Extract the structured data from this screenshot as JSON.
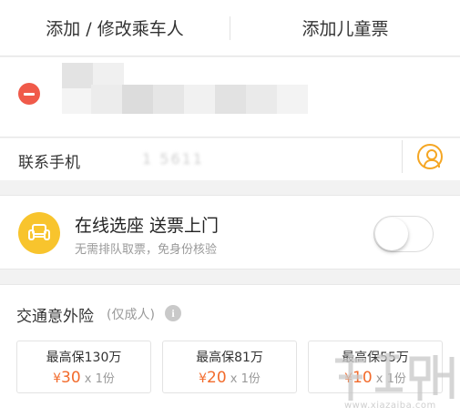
{
  "tabs": {
    "edit_passenger": "添加 / 修改乘车人",
    "add_child_ticket": "添加儿童票"
  },
  "contact": {
    "label": "联系手机",
    "phone": "1         5611"
  },
  "seat_service": {
    "title": "在线选座  送票上门",
    "subtitle": "无需排队取票，免身份核验",
    "toggle_on": false
  },
  "insurance": {
    "title": "交通意外险",
    "note": "(仅成人)",
    "info_icon_glyph": "i",
    "plans": [
      {
        "coverage": "最高保130万",
        "currency": "¥",
        "price": "30",
        "qty": "x 1份"
      },
      {
        "coverage": "最高保81万",
        "currency": "¥",
        "price": "20",
        "qty": "x 1份"
      },
      {
        "coverage": "最高保55万",
        "currency": "¥",
        "price": "10",
        "qty": "x 1份"
      }
    ]
  },
  "watermark": {
    "sub": "www.xiazaiba.com"
  },
  "colors": {
    "accent": "#f5a623",
    "price": "#f26b2c",
    "remove": "#f05a4a"
  },
  "icons": {
    "remove": "minus-circle-icon",
    "person": "person-icon",
    "seat": "sofa-icon",
    "info": "info-icon"
  }
}
